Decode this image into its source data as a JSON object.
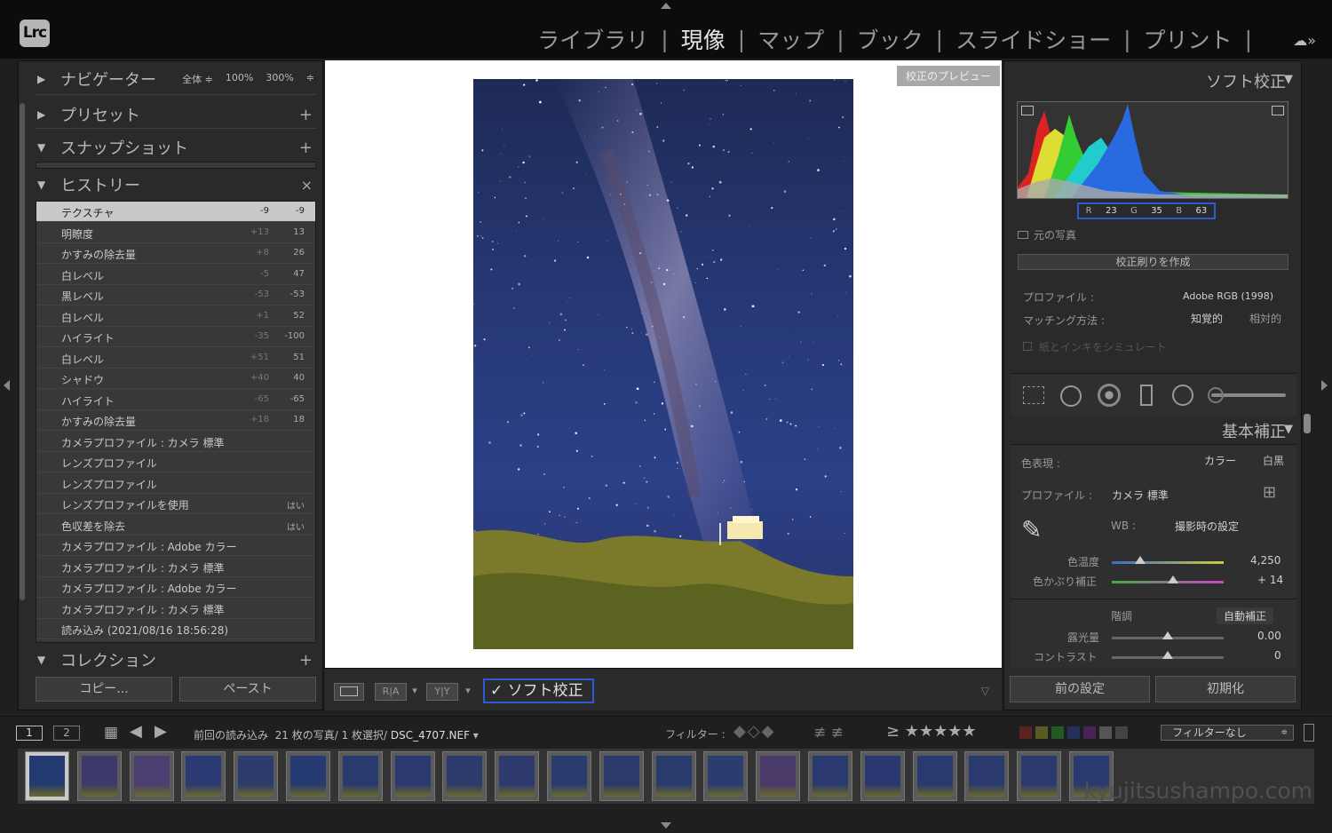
{
  "app": {
    "logo": "Lrc"
  },
  "modules": [
    "ライブラリ",
    "現像",
    "マップ",
    "ブック",
    "スライドショー",
    "プリント"
  ],
  "active_module": "現像",
  "left": {
    "navigator": {
      "title": "ナビゲーター",
      "opts": [
        "全体 ≑",
        "100%",
        "300%",
        "≑"
      ]
    },
    "presets": {
      "title": "プリセット",
      "action": "+"
    },
    "snapshots": {
      "title": "スナップショット",
      "action": "+"
    },
    "history": {
      "title": "ヒストリー",
      "action": "×",
      "items": [
        {
          "name": "テクスチャ",
          "delta": "-9",
          "value": "-9"
        },
        {
          "name": "明瞭度",
          "delta": "+13",
          "value": "13"
        },
        {
          "name": "かすみの除去量",
          "delta": "+8",
          "value": "26"
        },
        {
          "name": "白レベル",
          "delta": "-5",
          "value": "47"
        },
        {
          "name": "黒レベル",
          "delta": "-53",
          "value": "-53"
        },
        {
          "name": "白レベル",
          "delta": "+1",
          "value": "52"
        },
        {
          "name": "ハイライト",
          "delta": "-35",
          "value": "-100"
        },
        {
          "name": "白レベル",
          "delta": "+51",
          "value": "51"
        },
        {
          "name": "シャドウ",
          "delta": "+40",
          "value": "40"
        },
        {
          "name": "ハイライト",
          "delta": "-65",
          "value": "-65"
        },
        {
          "name": "かすみの除去量",
          "delta": "+18",
          "value": "18"
        },
        {
          "name": "カメラプロファイル : カメラ 標準",
          "delta": "",
          "value": ""
        },
        {
          "name": "レンズプロファイル",
          "delta": "",
          "value": ""
        },
        {
          "name": "レンズプロファイル",
          "delta": "",
          "value": ""
        },
        {
          "name": "レンズプロファイルを使用",
          "delta": "",
          "value": "はい"
        },
        {
          "name": "色収差を除去",
          "delta": "",
          "value": "はい"
        },
        {
          "name": "カメラプロファイル : Adobe カラー",
          "delta": "",
          "value": ""
        },
        {
          "name": "カメラプロファイル : カメラ 標準",
          "delta": "",
          "value": ""
        },
        {
          "name": "カメラプロファイル : Adobe カラー",
          "delta": "",
          "value": ""
        },
        {
          "name": "カメラプロファイル : カメラ 標準",
          "delta": "",
          "value": ""
        },
        {
          "name": "読み込み (2021/08/16 18:56:28)",
          "delta": "",
          "value": ""
        }
      ]
    },
    "collections": {
      "title": "コレクション",
      "action": "+"
    },
    "copy": "コピー...",
    "paste": "ペースト"
  },
  "center": {
    "preview_label": "校正のプレビュー",
    "toolbar": {
      "ra": "R|A",
      "yy": "Y|Y",
      "softproof": "ソフト校正",
      "softproof_check": "✓"
    }
  },
  "right": {
    "softproof_title": "ソフト校正",
    "rgb": {
      "r_label": "R",
      "r": "23",
      "g_label": "G",
      "g": "35",
      "b_label": "B",
      "b": "63"
    },
    "original_photo": "元の写真",
    "create_proof": "校正刷りを作成",
    "profile_label": "プロファイル :",
    "profile_value": "Adobe RGB (1998)",
    "matching_label": "マッチング方法 :",
    "matching_opts": [
      "知覚的",
      "相対的"
    ],
    "simulate": "紙とインキをシミュレート",
    "basic_title": "基本補正",
    "treatment_label": "色表現 :",
    "treatment_opts": [
      "カラー",
      "白黒"
    ],
    "bprofile_label": "プロファイル :",
    "bprofile_value": "カメラ 標準",
    "wb_label": "WB :",
    "wb_value": "撮影時の設定",
    "temp_label": "色温度",
    "temp_value": "4,250",
    "temp_level": 0.25,
    "tint_label": "色かぶり補正",
    "tint_value": "+ 14",
    "tint_level": 0.55,
    "tone_label": "階調",
    "auto": "自動補正",
    "exposure_label": "露光量",
    "exposure_value": "0.00",
    "exposure_level": 0.5,
    "contrast_label": "コントラスト",
    "contrast_value": "0",
    "contrast_level": 0.5,
    "prev": "前の設定",
    "reset": "初期化"
  },
  "filmbar": {
    "page1": "1",
    "page2": "2",
    "source": "前回の読み込み",
    "count": "21 枚の写真/ 1 枚選択/",
    "file": "DSC_4707.NEF",
    "filter_label": "フィルター :",
    "rating": "≥ ★★★★★",
    "filter_value": "フィルターなし"
  },
  "watermark": "kyujitsushampo.com",
  "colors": {
    "highlight": "#2d5bd6",
    "panel": "#2a2a2a"
  }
}
